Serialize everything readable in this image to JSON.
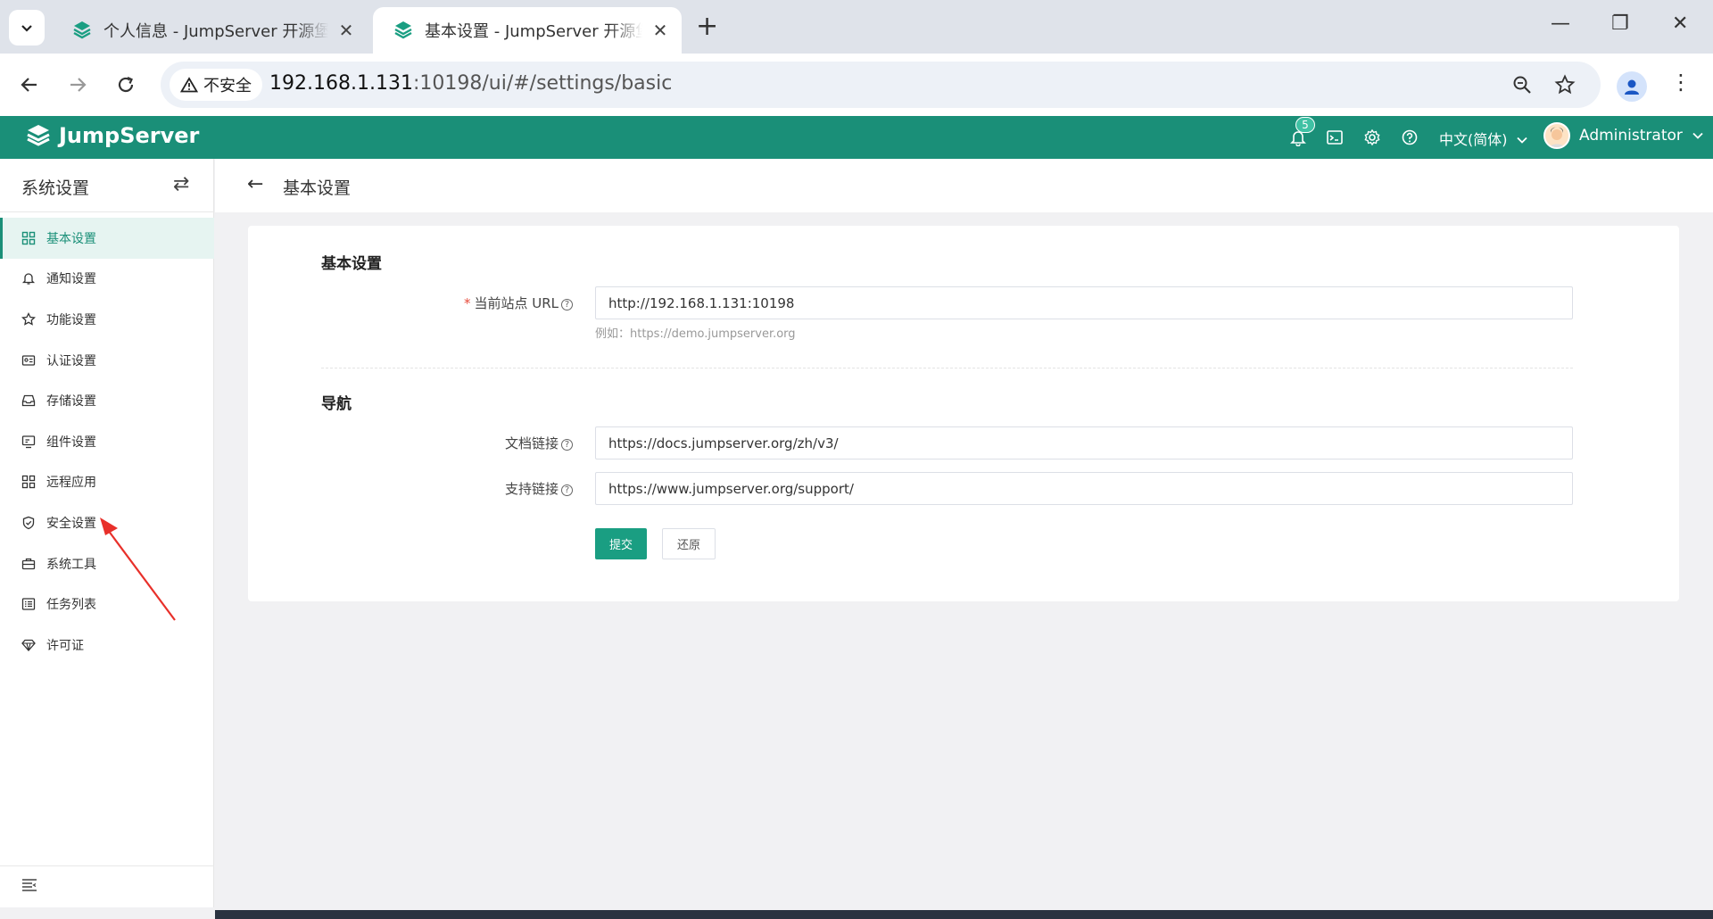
{
  "browser": {
    "tabs": [
      {
        "title": "个人信息 - JumpServer 开源堡垒机",
        "active": false
      },
      {
        "title": "基本设置 - JumpServer 开源堡垒机",
        "active": true
      }
    ],
    "new_tab": "+",
    "security_label": "不安全",
    "url_host": "192.168.1.131",
    "url_rest": ":10198/ui/#/settings/basic"
  },
  "header": {
    "brand": "JumpServer",
    "notification_count": "5",
    "language": "中文(简体)",
    "user": "Administrator",
    "accent": "#1a8f78"
  },
  "sidebar": {
    "title": "系统设置",
    "items": [
      {
        "label": "基本设置",
        "icon": "grid-icon",
        "active": true
      },
      {
        "label": "通知设置",
        "icon": "bell-icon",
        "active": false
      },
      {
        "label": "功能设置",
        "icon": "feature-icon",
        "active": false
      },
      {
        "label": "认证设置",
        "icon": "id-card-icon",
        "active": false
      },
      {
        "label": "存储设置",
        "icon": "inbox-icon",
        "active": false
      },
      {
        "label": "组件设置",
        "icon": "monitor-icon",
        "active": false
      },
      {
        "label": "远程应用",
        "icon": "apps-icon",
        "active": false
      },
      {
        "label": "安全设置",
        "icon": "shield-icon",
        "active": false
      },
      {
        "label": "系统工具",
        "icon": "toolbox-icon",
        "active": false
      },
      {
        "label": "任务列表",
        "icon": "list-icon",
        "active": false
      },
      {
        "label": "许可证",
        "icon": "diamond-icon",
        "active": false
      }
    ]
  },
  "page": {
    "title": "基本设置",
    "section_basic": "基本设置",
    "site_url_label": "当前站点 URL",
    "site_url_value": "http://192.168.1.131:10198",
    "site_url_hint": "例如：https://demo.jumpserver.org",
    "section_nav": "导航",
    "docs_label": "文档链接",
    "docs_value": "https://docs.jumpserver.org/zh/v3/",
    "support_label": "支持链接",
    "support_value": "https://www.jumpserver.org/support/",
    "submit": "提交",
    "reset": "还原"
  }
}
